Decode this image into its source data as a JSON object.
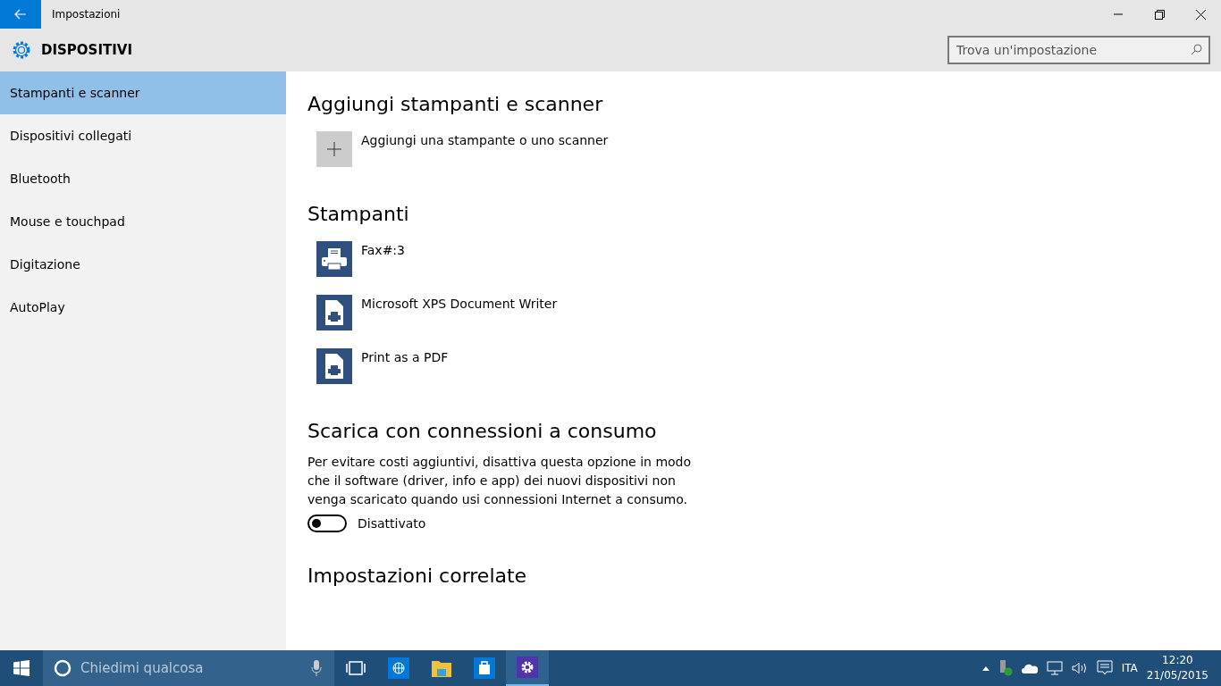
{
  "window": {
    "title": "Impostazioni"
  },
  "header": {
    "title": "DISPOSITIVI",
    "search": {
      "placeholder": "Trova un'impostazione"
    }
  },
  "sidebar": {
    "items": [
      {
        "label": "Stampanti e scanner",
        "selected": true
      },
      {
        "label": "Dispositivi collegati",
        "selected": false
      },
      {
        "label": "Bluetooth",
        "selected": false
      },
      {
        "label": "Mouse e touchpad",
        "selected": false
      },
      {
        "label": "Digitazione",
        "selected": false
      },
      {
        "label": "AutoPlay",
        "selected": false
      }
    ]
  },
  "add_section": {
    "title": "Aggiungi stampanti e scanner",
    "action": "Aggiungi una stampante o uno scanner"
  },
  "printers_section": {
    "title": "Stampanti",
    "items": [
      {
        "name": "Fax#:3",
        "kind": "fax"
      },
      {
        "name": "Microsoft XPS Document Writer",
        "kind": "file"
      },
      {
        "name": "Print as a PDF",
        "kind": "file"
      }
    ]
  },
  "metered_section": {
    "title": "Scarica con connessioni a consumo",
    "description": "Per evitare costi aggiuntivi, disattiva questa opzione in modo che il software (driver, info e app) dei nuovi dispositivi non venga scaricato quando usi connessioni Internet a consumo.",
    "toggle": {
      "on": false,
      "label": "Disattivato"
    }
  },
  "related_section": {
    "title": "Impostazioni correlate"
  },
  "taskbar": {
    "search_placeholder": "Chiedimi qualcosa",
    "apps": [
      {
        "kind": "taskview",
        "selected": false
      },
      {
        "kind": "browser",
        "selected": false
      },
      {
        "kind": "explorer",
        "selected": false
      },
      {
        "kind": "store",
        "selected": false
      },
      {
        "kind": "settings",
        "selected": true
      }
    ],
    "language": "ITA",
    "time": "12:20",
    "date": "21/05/2015"
  }
}
